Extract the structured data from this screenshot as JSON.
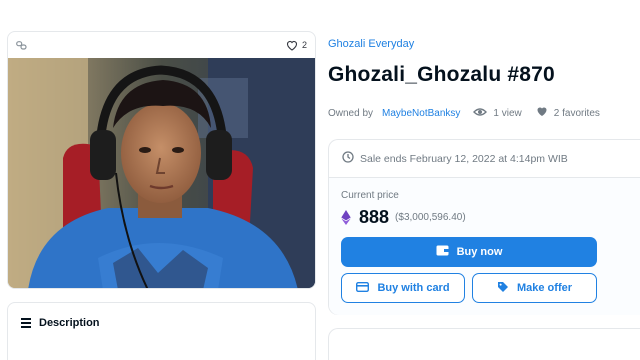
{
  "card": {
    "favorite_count": "2"
  },
  "description": {
    "heading": "Description"
  },
  "item": {
    "collection": "Ghozali Everyday",
    "title": "Ghozali_Ghozalu #870",
    "owned_by_label": "Owned by",
    "owner": "MaybeNotBanksy",
    "views": "1 view",
    "favorites": "2 favorites"
  },
  "sale": {
    "ends_text": "Sale ends February 12, 2022 at 4:14pm WIB",
    "current_price_label": "Current price",
    "price": "888",
    "price_usd": "($3,000,596.40)",
    "currency_icon": "ethereum-icon"
  },
  "actions": {
    "buy_now": "Buy now",
    "buy_with_card": "Buy with card",
    "make_offer": "Make offer"
  },
  "colors": {
    "accent": "#2081e2",
    "text": "#04111d",
    "muted": "#707a83",
    "border": "#e5e8eb"
  }
}
